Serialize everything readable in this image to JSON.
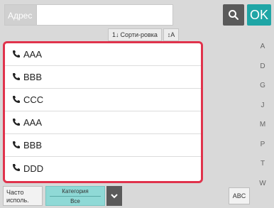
{
  "address": {
    "label": "Адрес",
    "value": ""
  },
  "ok_label": "OK",
  "sort": {
    "label": "Сорти-ровка",
    "az_label": "A"
  },
  "contacts": [
    {
      "name": "AAA"
    },
    {
      "name": "BBB"
    },
    {
      "name": "CCC"
    },
    {
      "name": "AAA"
    },
    {
      "name": "BBB"
    },
    {
      "name": "DDD"
    }
  ],
  "index_letters": [
    "A",
    "D",
    "G",
    "J",
    "M",
    "P",
    "T",
    "W"
  ],
  "bottom": {
    "frequent_label": "Часто исполь.",
    "category_title": "Категория",
    "category_value": "Все",
    "abc_label": "ABC"
  },
  "colors": {
    "ok_accent": "#1fa6a6",
    "list_highlight": "#e0334c",
    "category_bg": "#8fd9d6"
  }
}
